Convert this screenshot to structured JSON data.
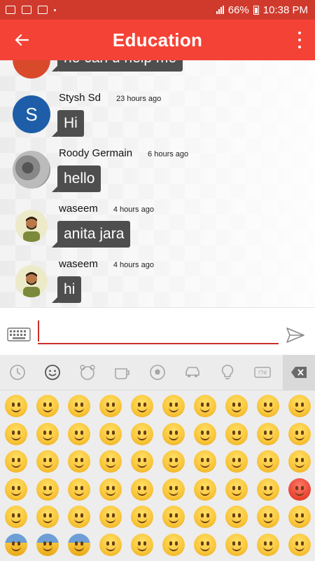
{
  "status_bar": {
    "signal_icon": "signal-icon",
    "battery": "66%",
    "time": "10:38 PM"
  },
  "app_bar": {
    "title": "Education",
    "back_icon": "arrow-left-icon",
    "menu_icon": "more-vertical-icon"
  },
  "messages": [
    {
      "sender": "",
      "time": "",
      "text": "he can u help me",
      "avatar": "red-avatar"
    },
    {
      "sender": "Stysh Sd",
      "time": "23 hours ago",
      "text": "Hi",
      "avatar": "S"
    },
    {
      "sender": "Roody Germain",
      "time": "6 hours ago",
      "text": "hello",
      "avatar": "photo-avatar"
    },
    {
      "sender": "waseem",
      "time": "4 hours ago",
      "text": "anita jara",
      "avatar": "cartoon-avatar"
    },
    {
      "sender": "waseem",
      "time": "4 hours ago",
      "text": "hi",
      "avatar": "cartoon-avatar"
    }
  ],
  "composer": {
    "value": "",
    "placeholder": "",
    "keyboard_icon": "keyboard-icon",
    "send_icon": "send-icon"
  },
  "emoji_tabs": [
    {
      "icon": "clock-icon"
    },
    {
      "icon": "smiley-icon",
      "active": true
    },
    {
      "icon": "animal-icon"
    },
    {
      "icon": "cup-icon"
    },
    {
      "icon": "ball-icon"
    },
    {
      "icon": "car-icon"
    },
    {
      "icon": "bulb-icon"
    },
    {
      "icon": "symbols-icon",
      "label": "!?#"
    },
    {
      "icon": "backspace-icon"
    }
  ],
  "colors": {
    "status_bar": "#d03a2d",
    "app_bar": "#f44336",
    "bubble": "#4e4e4e",
    "input_underline": "#c9302c"
  }
}
